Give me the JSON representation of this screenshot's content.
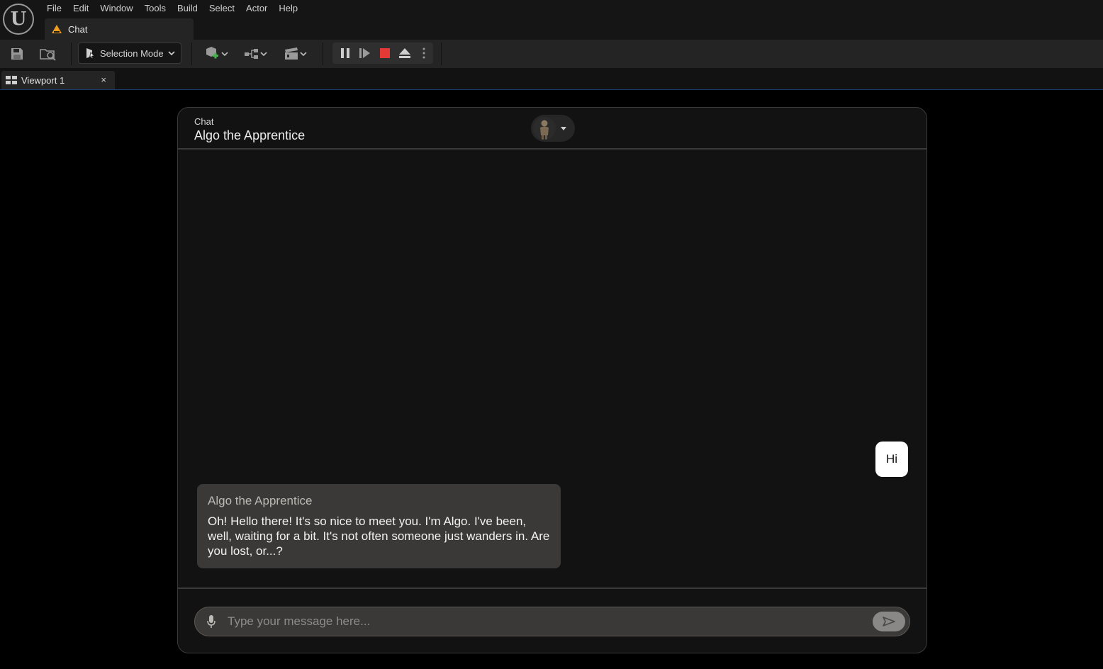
{
  "app": {
    "logo_icon": "unreal-engine-logo-icon",
    "menu": [
      "File",
      "Edit",
      "Window",
      "Tools",
      "Build",
      "Select",
      "Actor",
      "Help"
    ],
    "document_tab": {
      "label": "Chat",
      "icon": "level-warning-icon"
    }
  },
  "toolbar": {
    "save_icon": "save-icon",
    "browse_icon": "content-browser-icon",
    "mode_label": "Selection Mode",
    "add_icon": "add-actor-icon",
    "blueprint_icon": "blueprint-icon",
    "cinematics_icon": "cinematics-icon",
    "play_controls": [
      "pause-icon",
      "step-frame-icon",
      "stop-icon",
      "eject-icon",
      "more-options-icon"
    ]
  },
  "viewport_tab": {
    "label": "Viewport 1",
    "close": "×"
  },
  "chat": {
    "kicker": "Chat",
    "title": "Algo the Apprentice",
    "messages": [
      {
        "role": "user",
        "text": "Hi"
      },
      {
        "role": "assistant",
        "name": "Algo the Apprentice",
        "text": "Oh! Hello there! It's so nice to meet you. I'm Algo. I've been, well, waiting for a bit. It's not often someone just wanders in. Are you lost, or...?"
      }
    ],
    "input": {
      "placeholder": "Type your message here...",
      "value": ""
    }
  },
  "colors": {
    "stop_red": "#e53935",
    "level_orange": "#f0a020",
    "add_green": "#4caf50",
    "user_bubble": "#ffffff",
    "bot_bubble": "#3b3937"
  }
}
